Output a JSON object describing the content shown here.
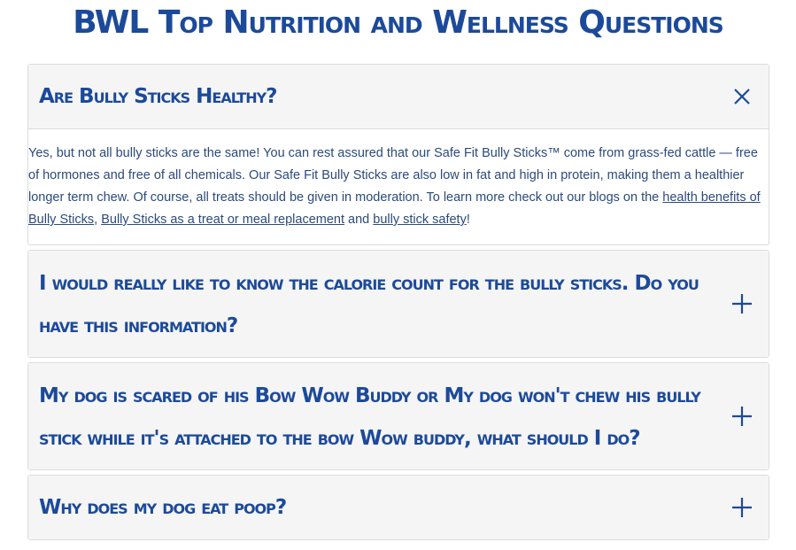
{
  "page": {
    "title": "BWL Top Nutrition and Wellness Questions"
  },
  "faqs": [
    {
      "question": "Are Bully Sticks Healthy?",
      "expanded": true,
      "toggle_icon": "close-icon",
      "answer": {
        "text": "Yes, but not all bully sticks are the same! You can rest assured that our Safe Fit Bully Sticks™ come from grass-fed cattle — free of hormones and free of all chemicals. Our Safe Fit Bully Sticks are also low in fat and high in protein, making them a healthier longer term chew. Of course, all treats should be given in moderation. To learn more check out our blogs on the ",
        "link1": "health benefits of Bully Sticks",
        "sep1": ", ",
        "link2": "Bully Sticks as a treat or meal replacement",
        "sep2": " and ",
        "link3": "bully stick safety",
        "end": "!"
      }
    },
    {
      "question": "I would really like to know the calorie count for the bully sticks. Do you have this information?",
      "expanded": false,
      "toggle_icon": "plus-icon"
    },
    {
      "question": "My dog is scared of his Bow Wow Buddy or My dog won't chew his bully stick while it's attached to the bow Wow buddy, what should I do?",
      "expanded": false,
      "toggle_icon": "plus-icon"
    },
    {
      "question": "Why does my dog eat poop?",
      "expanded": false,
      "toggle_icon": "plus-icon"
    }
  ],
  "colors": {
    "heading": "#1c4a9a",
    "body_text": "#2b4a7c",
    "header_bg": "#f5f5f5",
    "border": "#dcdcdc"
  }
}
